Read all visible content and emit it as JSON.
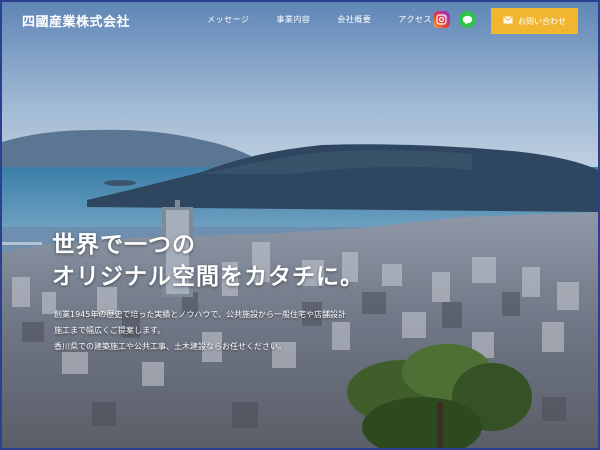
{
  "header": {
    "logo": "四國産業株式会社",
    "nav": [
      "メッセージ",
      "事業内容",
      "会社概要",
      "アクセス"
    ],
    "social": [
      "instagram-icon",
      "line-icon"
    ],
    "contact_label": "お問い合わせ"
  },
  "hero": {
    "title_lines": [
      "世界で一つの",
      "オリジナル空間をカタチに。"
    ],
    "description_lines": [
      "創業1945年の歴史で培った実績とノウハウで、公共施設から一般住宅や店舗設計",
      "施工まで幅広くご提案します。",
      "香川県での建築施工や公共工事、土木建設ならお任せください。"
    ]
  },
  "colors": {
    "accent": "#f2b530",
    "frame_border": "#2d3f8f",
    "line_green": "#2fc24a"
  }
}
